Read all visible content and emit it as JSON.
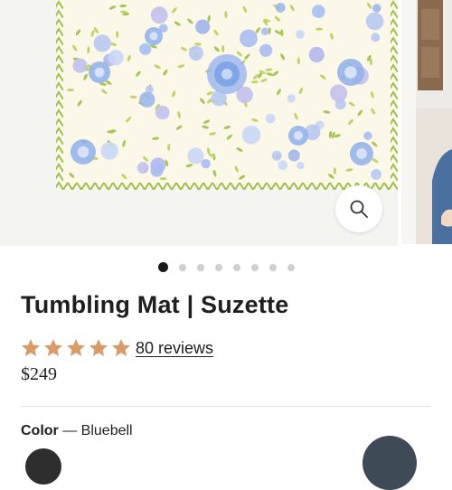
{
  "product": {
    "title": "Tumbling Mat | Suzette",
    "rating_stars": 5,
    "reviews_label": "80 reviews",
    "price": "$249",
    "color_label": "Color",
    "color_separator": " — ",
    "color_value": "Bluebell"
  },
  "gallery": {
    "slide_count": 8,
    "active_slide": 1,
    "zoom_icon": "magnifier-icon"
  },
  "colors": {
    "star": "#d99b6a",
    "text": "#1f1f1f",
    "dot_active": "#1a1a1a",
    "dot_inactive": "#cfcfcf"
  }
}
